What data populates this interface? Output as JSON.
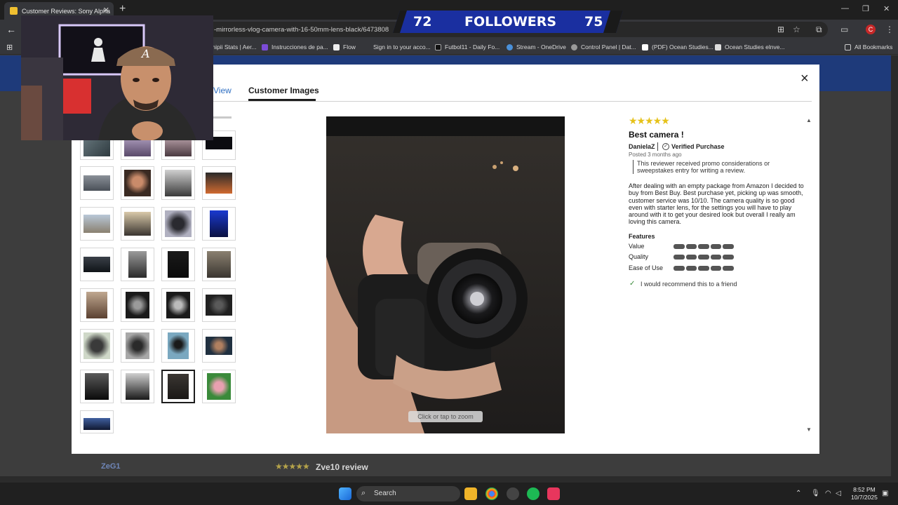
{
  "browser": {
    "tab_title": "Customer Reviews: Sony Alpha",
    "new_tab": "+",
    "url": "-mirrorless-vlog-camera-with-16-50mm-lens-black/6473808",
    "all_bookmarks": "All Bookmarks",
    "bookmarks": [
      "mipii Stats | Aer...",
      "Instrucciones de pa...",
      "Flow",
      "Sign in to your acco...",
      "Futbol11 - Daily Fo...",
      "Stream - OneDrive",
      "Control Panel | Dat...",
      "(PDF) Ocean Studies...",
      "Ocean Studies elnve..."
    ],
    "profile_initial": "C"
  },
  "overlay": {
    "followers_left": "72",
    "followers_label": "FOLLOWERS",
    "followers_right": "75"
  },
  "modal": {
    "tab_view": "View",
    "tab_images": "Customer Images",
    "close_icon": "×",
    "zoom_hint": "Click or tap to zoom"
  },
  "review": {
    "stars": "★★★★★",
    "title": "Best camera !",
    "author": "DanielaZ",
    "verified": "Verified Purchase",
    "posted": "Posted 3 months ago",
    "promo_note": "This reviewer received promo considerations or sweepstakes entry for writing a review.",
    "body": "After dealing with an empty package from Amazon I decided to buy from Best Buy. Best purchase yet, picking up was smooth, customer service was 10/10. The camera quality is so good even with starter lens, for the settings you will have to play around with it to get your desired look but overall I really am loving this camera.",
    "features_heading": "Features",
    "features": [
      {
        "label": "Value",
        "rating": 5
      },
      {
        "label": "Quality",
        "rating": 5
      },
      {
        "label": "Ease of Use",
        "rating": 5
      }
    ],
    "recommend": "I would recommend this to a friend"
  },
  "background_page": {
    "reviewer": "ZeG1",
    "review_stars": "★★★★★",
    "review_title": "Zve10 review"
  },
  "taskbar": {
    "search_label": "Search",
    "time": "8:52 PM",
    "date": "10/7/2025"
  },
  "colors": {
    "modal_bg": "#ffffff",
    "page_blue": "#1e3a7a",
    "star_yellow": "#e6c21a",
    "link_blue": "#2f6fc2"
  }
}
